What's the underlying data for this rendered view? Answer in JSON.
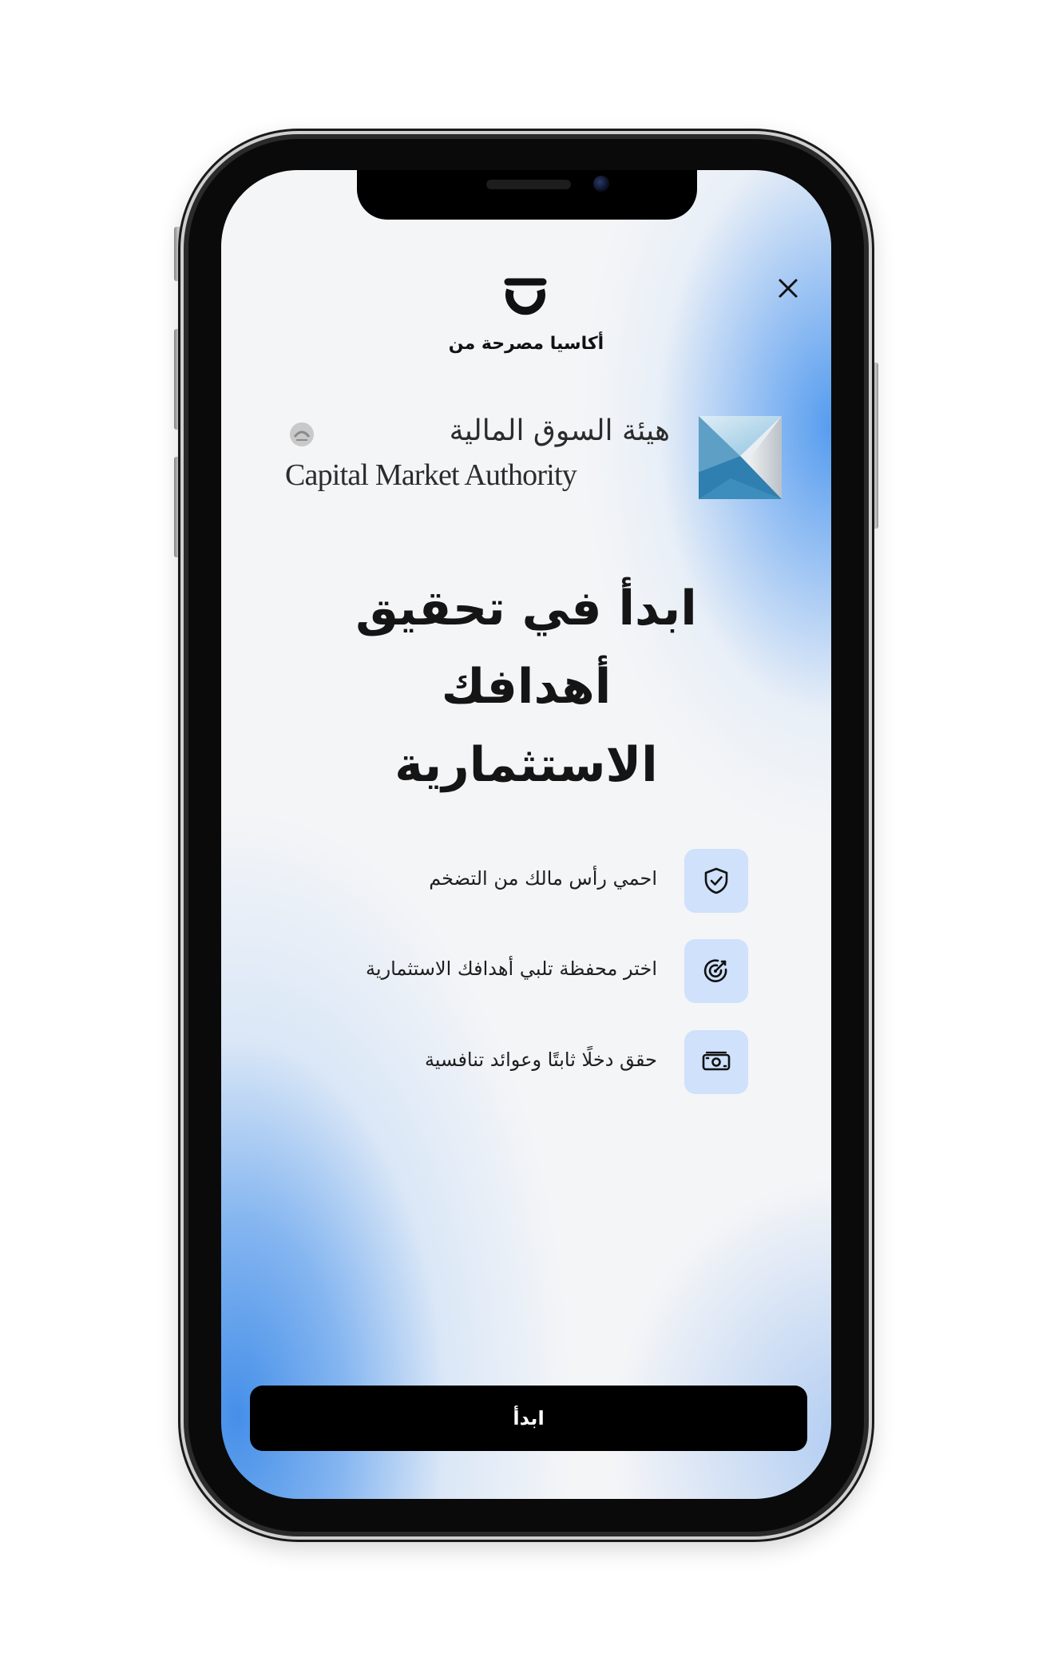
{
  "header": {
    "close_icon": "close-icon",
    "brand_icon": "acasia-logo-icon",
    "licensed_by": "أكاسيا مصرحة من"
  },
  "regulator": {
    "name_ar": "هيئة السوق المالية",
    "name_en": "Capital Market Authority",
    "emblem_icon": "cma-emblem-icon",
    "seal_icon": "cma-seal-icon"
  },
  "headline": {
    "line1": "ابدأ في تحقيق",
    "line2": "أهدافك",
    "line3": "الاستثمارية"
  },
  "features": [
    {
      "icon": "shield-check-icon",
      "text": "احمي رأس مالك من التضخم"
    },
    {
      "icon": "target-icon",
      "text": "اختر محفظة تلبي أهدافك الاستثمارية"
    },
    {
      "icon": "banknote-icon",
      "text": "حقق دخلًا ثابتًا وعوائد تنافسية"
    }
  ],
  "cta": {
    "start_label": "ابدأ"
  },
  "colors": {
    "accent_blue": "#4a96ee",
    "icon_bg": "#cfe1fb",
    "button_bg": "#000000",
    "text_primary": "#151515"
  }
}
